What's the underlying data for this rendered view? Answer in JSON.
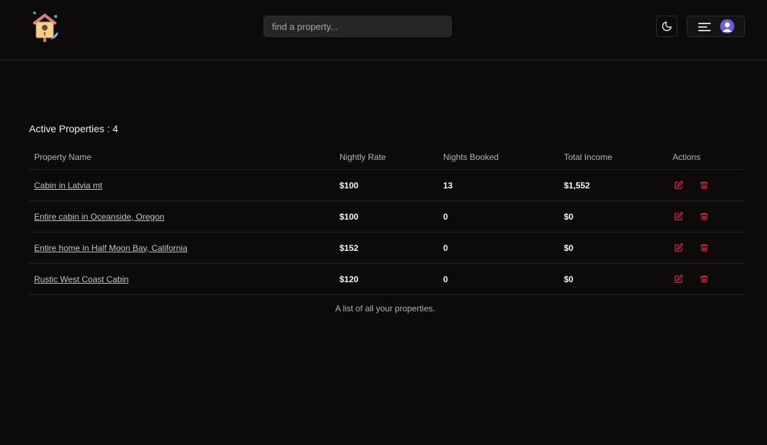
{
  "header": {
    "logo_icon": "birdhouse-logo-icon",
    "search": {
      "placeholder": "find a property...",
      "value": ""
    },
    "theme_toggle_icon": "moon-icon",
    "menu_icon": "hamburger-menu-icon",
    "avatar_icon": "user-avatar-icon"
  },
  "main": {
    "heading": "Active Properties : 4",
    "columns": {
      "name": "Property Name",
      "rate": "Nightly Rate",
      "nights": "Nights Booked",
      "income": "Total Income",
      "actions": "Actions"
    },
    "rows": [
      {
        "name": "Cabin in Latvia mt",
        "rate": "$100",
        "nights": "13",
        "income": "$1,552"
      },
      {
        "name": "Entire cabin in Oceanside, Oregon",
        "rate": "$100",
        "nights": "0",
        "income": "$0"
      },
      {
        "name": "Entire home in Half Moon Bay, California",
        "rate": "$152",
        "nights": "0",
        "income": "$0"
      },
      {
        "name": "Rustic West Coast Cabin",
        "rate": "$120",
        "nights": "0",
        "income": "$0"
      }
    ],
    "row_action_icons": [
      "edit-icon",
      "trash-icon"
    ],
    "caption": "A list of all your properties."
  },
  "colors": {
    "background": "#0c0b0a",
    "action_red": "#e0263e",
    "avatar": "#6d5ce8"
  }
}
